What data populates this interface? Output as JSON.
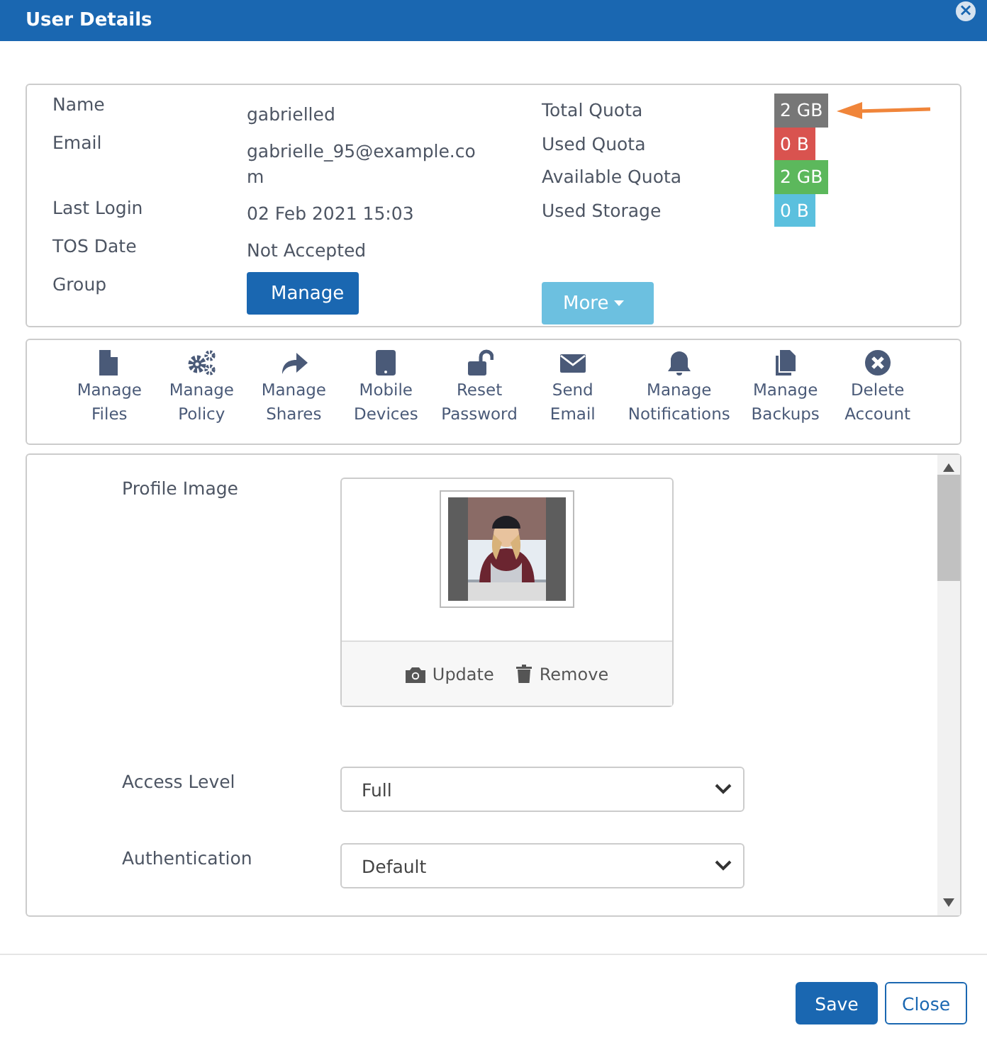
{
  "window": {
    "title": "User Details",
    "close": "×"
  },
  "info": {
    "fields": [
      {
        "label": "Name",
        "value": "gabrielled"
      },
      {
        "label": "Email",
        "value": "gabrielle_95@example.com"
      },
      {
        "label": "Last Login",
        "value": "02 Feb 2021 15:03"
      },
      {
        "label": "TOS Date",
        "value": "Not Accepted"
      },
      {
        "label": "Group"
      }
    ],
    "manage_button": "Manage",
    "quotas": [
      {
        "label": "Total Quota",
        "value": "2 GB",
        "color": "#777777"
      },
      {
        "label": "Used Quota",
        "value": "0 B",
        "color": "#d9534f"
      },
      {
        "label": "Available Quota",
        "value": "2 GB",
        "color": "#5cb85c"
      },
      {
        "label": "Used Storage",
        "value": "0 B",
        "color": "#5bc0de"
      }
    ],
    "more_button": "More"
  },
  "actions": [
    {
      "label": "Manage Files"
    },
    {
      "label": "Manage Policy"
    },
    {
      "label": "Manage Shares"
    },
    {
      "label": "Mobile Devices"
    },
    {
      "label": "Reset Password"
    },
    {
      "label": "Send Email"
    },
    {
      "label": "Manage Notifications"
    },
    {
      "label": "Manage Backups"
    },
    {
      "label": "Delete Account"
    }
  ],
  "form": {
    "profile_image": {
      "label": "Profile Image",
      "update": "Update",
      "remove": "Remove"
    },
    "selects": [
      {
        "label": "Access Level",
        "value": "Full"
      },
      {
        "label": "Authentication",
        "value": "Default"
      }
    ]
  },
  "footer": {
    "buttons": [
      {
        "label": "Save",
        "kind": "primary"
      },
      {
        "label": "Close",
        "kind": "secondary"
      }
    ]
  }
}
